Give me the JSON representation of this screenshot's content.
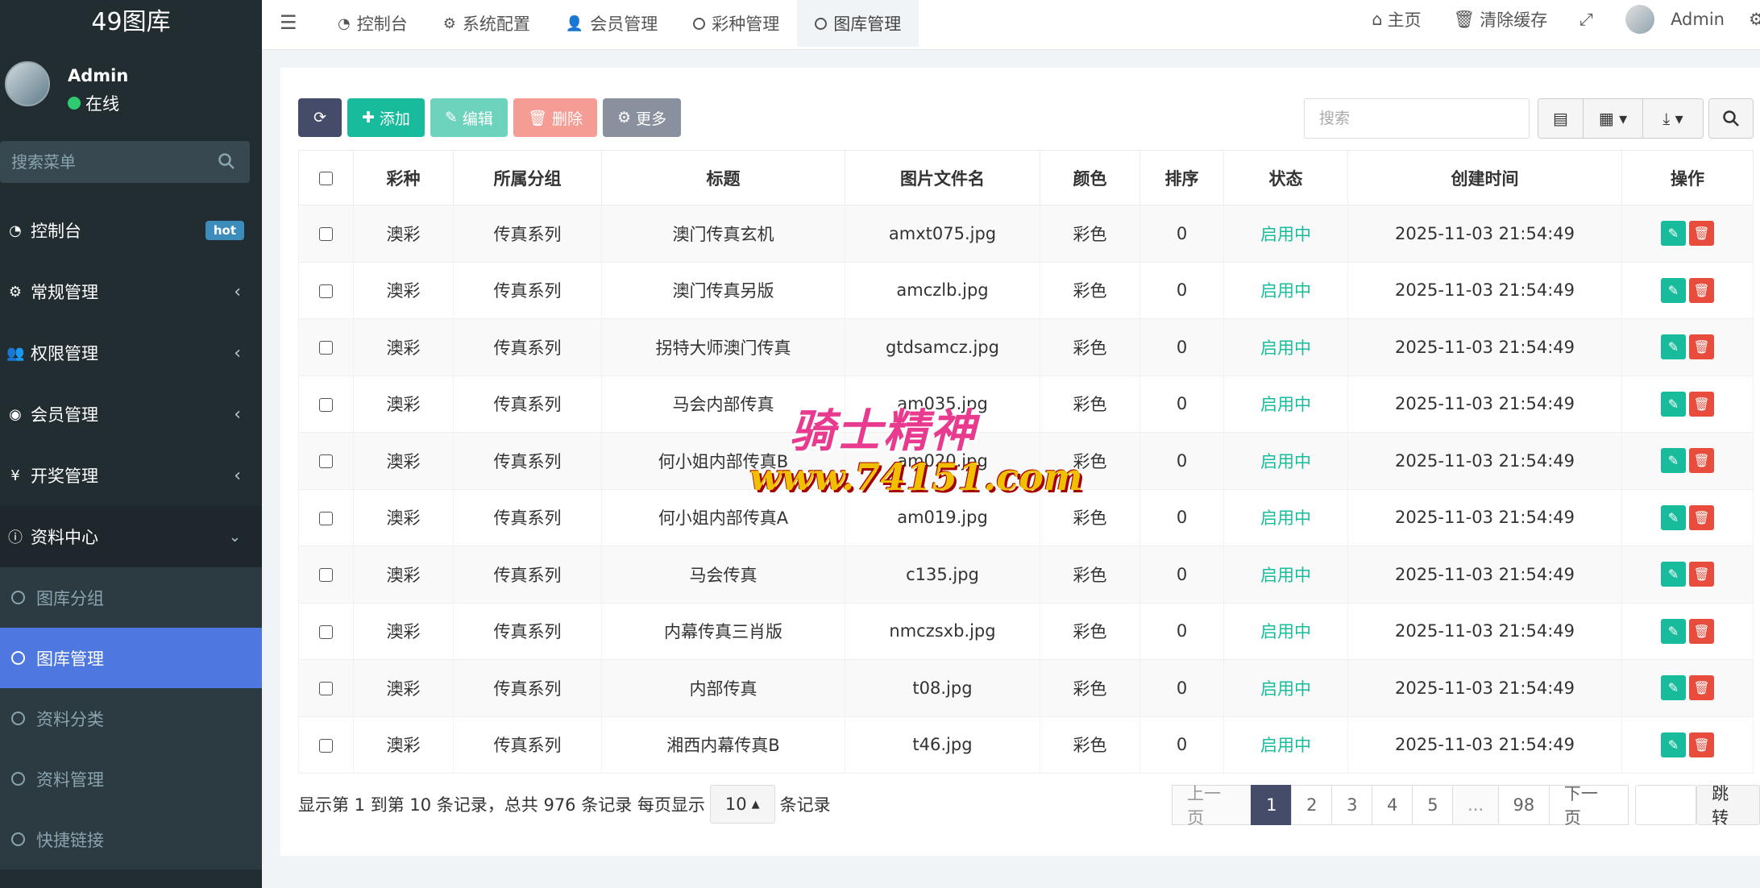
{
  "sidebar": {
    "brand": "49图库",
    "user": {
      "name": "Admin",
      "status": "在线"
    },
    "search_placeholder": "搜索菜单",
    "menu": [
      {
        "label": "控制台",
        "icon": "dashboard-icon",
        "badge": "hot"
      },
      {
        "label": "常规管理",
        "icon": "cogs-icon"
      },
      {
        "label": "权限管理",
        "icon": "group-icon"
      },
      {
        "label": "会员管理",
        "icon": "user-circle-icon"
      },
      {
        "label": "开奖管理",
        "icon": "yen-icon"
      },
      {
        "label": "资料中心",
        "icon": "info-circle-icon"
      }
    ],
    "submenu": [
      {
        "label": "图库分组"
      },
      {
        "label": "图库管理"
      },
      {
        "label": "资料分类"
      },
      {
        "label": "资料管理"
      },
      {
        "label": "快捷链接"
      }
    ]
  },
  "header": {
    "tabs": [
      {
        "label": "控制台",
        "icon": "dashboard-icon"
      },
      {
        "label": "系统配置",
        "icon": "cog-icon"
      },
      {
        "label": "会员管理",
        "icon": "user-icon"
      },
      {
        "label": "彩种管理",
        "icon": "circle-icon"
      },
      {
        "label": "图库管理",
        "icon": "circle-icon"
      }
    ],
    "home": "主页",
    "clear_cache": "清除缓存",
    "admin": "Admin"
  },
  "toolbar": {
    "add": "添加",
    "edit": "编辑",
    "delete": "删除",
    "more": "更多",
    "search_placeholder": "搜索"
  },
  "table": {
    "headers": [
      "彩种",
      "所属分组",
      "标题",
      "图片文件名",
      "颜色",
      "排序",
      "状态",
      "创建时间",
      "操作"
    ],
    "rows": [
      {
        "lottery": "澳彩",
        "group": "传真系列",
        "title": "澳门传真玄机",
        "file": "amxt075.jpg",
        "color": "彩色",
        "sort": "0",
        "status": "启用中",
        "created": "2025-11-03 21:54:49"
      },
      {
        "lottery": "澳彩",
        "group": "传真系列",
        "title": "澳门传真另版",
        "file": "amczlb.jpg",
        "color": "彩色",
        "sort": "0",
        "status": "启用中",
        "created": "2025-11-03 21:54:49"
      },
      {
        "lottery": "澳彩",
        "group": "传真系列",
        "title": "拐特大师澳门传真",
        "file": "gtdsamcz.jpg",
        "color": "彩色",
        "sort": "0",
        "status": "启用中",
        "created": "2025-11-03 21:54:49"
      },
      {
        "lottery": "澳彩",
        "group": "传真系列",
        "title": "马会内部传真",
        "file": "am035.jpg",
        "color": "彩色",
        "sort": "0",
        "status": "启用中",
        "created": "2025-11-03 21:54:49"
      },
      {
        "lottery": "澳彩",
        "group": "传真系列",
        "title": "何小姐内部传真B",
        "file": "am020.jpg",
        "color": "彩色",
        "sort": "0",
        "status": "启用中",
        "created": "2025-11-03 21:54:49"
      },
      {
        "lottery": "澳彩",
        "group": "传真系列",
        "title": "何小姐内部传真A",
        "file": "am019.jpg",
        "color": "彩色",
        "sort": "0",
        "status": "启用中",
        "created": "2025-11-03 21:54:49"
      },
      {
        "lottery": "澳彩",
        "group": "传真系列",
        "title": "马会传真",
        "file": "c135.jpg",
        "color": "彩色",
        "sort": "0",
        "status": "启用中",
        "created": "2025-11-03 21:54:49"
      },
      {
        "lottery": "澳彩",
        "group": "传真系列",
        "title": "内幕传真三肖版",
        "file": "nmczsxb.jpg",
        "color": "彩色",
        "sort": "0",
        "status": "启用中",
        "created": "2025-11-03 21:54:49"
      },
      {
        "lottery": "澳彩",
        "group": "传真系列",
        "title": "内部传真",
        "file": "t08.jpg",
        "color": "彩色",
        "sort": "0",
        "status": "启用中",
        "created": "2025-11-03 21:54:49"
      },
      {
        "lottery": "澳彩",
        "group": "传真系列",
        "title": "湘西内幕传真B",
        "file": "t46.jpg",
        "color": "彩色",
        "sort": "0",
        "status": "启用中",
        "created": "2025-11-03 21:54:49"
      }
    ]
  },
  "footer": {
    "info_prefix": "显示第 1 到第 10 条记录，总共 976 条记录 每页显示",
    "page_size": "10",
    "info_suffix": "条记录",
    "prev": "上一页",
    "pages": [
      "1",
      "2",
      "3",
      "4",
      "5",
      "...",
      "98"
    ],
    "next": "下一页",
    "jump": "跳转"
  },
  "watermark": {
    "line1": "骑士精神",
    "line2": "www.74151.com"
  }
}
